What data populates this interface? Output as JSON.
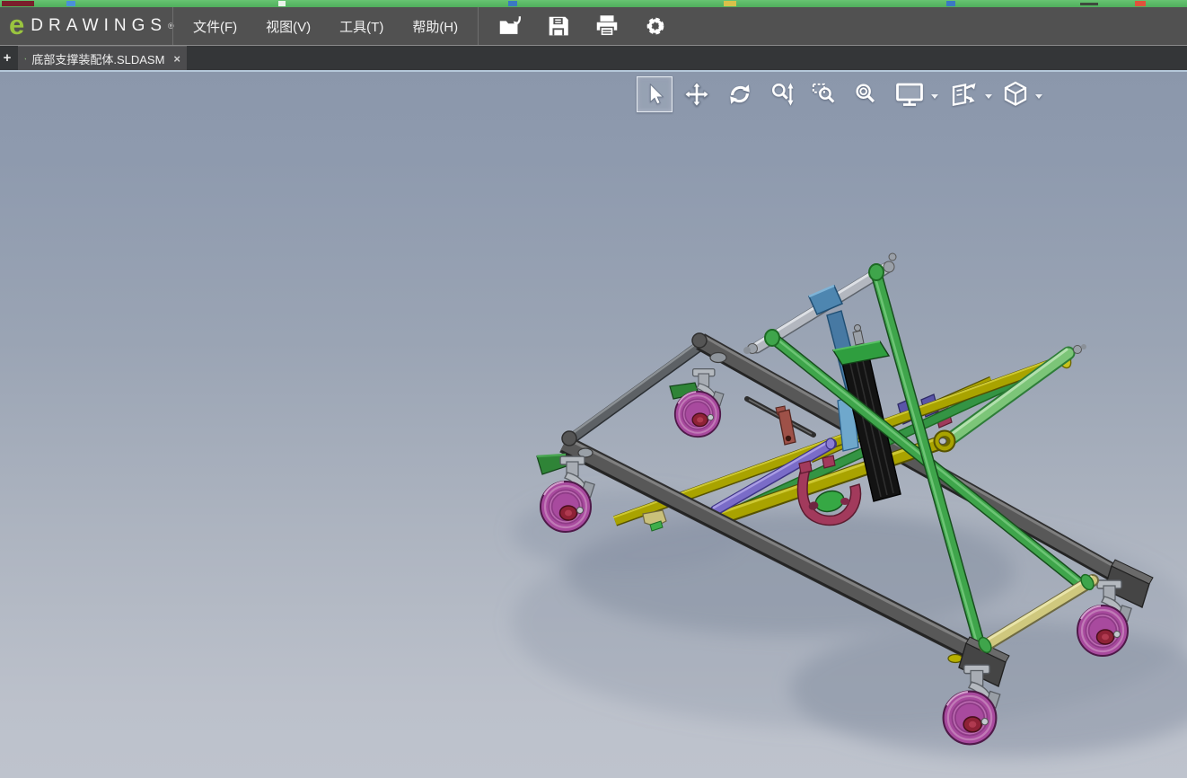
{
  "header": {
    "logo": {
      "e": "e",
      "wordmark": "DRAWINGS",
      "registered": "®"
    },
    "menus": [
      {
        "label": "文件(F)"
      },
      {
        "label": "视图(V)"
      },
      {
        "label": "工具(T)"
      },
      {
        "label": "帮助(H)"
      }
    ],
    "toolbar": [
      {
        "name": "open",
        "icon": "open-file-icon"
      },
      {
        "name": "save",
        "icon": "save-icon"
      },
      {
        "name": "print",
        "icon": "print-icon"
      },
      {
        "name": "settings",
        "icon": "gear-icon"
      }
    ]
  },
  "tab_bar": {
    "new_tab_label": "+",
    "tabs": [
      {
        "title": "底部支撑装配体.SLDASM",
        "close_label": "×",
        "active": true,
        "icon": "assembly-icon"
      }
    ]
  },
  "view_toolbar": {
    "buttons": [
      {
        "name": "select",
        "icon": "cursor-icon",
        "active": true
      },
      {
        "name": "pan",
        "icon": "pan-icon"
      },
      {
        "name": "rotate",
        "icon": "rotate-icon"
      },
      {
        "name": "zoom",
        "icon": "zoom-icon"
      },
      {
        "name": "zoom-window",
        "icon": "zoom-window-icon"
      },
      {
        "name": "zoom-fit",
        "icon": "zoom-fit-icon"
      },
      {
        "name": "full-screen",
        "icon": "monitor-icon",
        "has_dropdown": true
      },
      {
        "name": "reset-view",
        "icon": "pages-icon",
        "has_dropdown": true
      },
      {
        "name": "view-orientation",
        "icon": "cube-icon",
        "has_dropdown": true
      }
    ]
  },
  "viewport": {
    "model_name": "底部支撑装配体",
    "colors": {
      "brand_green": "#9ac43f",
      "menubar_bg": "#515151",
      "tabbar_bg": "#343638",
      "viewport_top": "#8b97ab",
      "viewport_bottom": "#bec3cd",
      "frame_gray": "#585858",
      "arm_green": "#3fa54b",
      "bar_yellow": "#a9a300",
      "wheel_magenta": "#a84a9e",
      "hub_red": "#8e2236",
      "rod_silver": "#b3b7bf",
      "clamp_blue": "#4e86b0",
      "rod_purple": "#7a6cc8",
      "bracket_maroon": "#a23a5c",
      "actuator_black": "#161616",
      "cylinder_light_green": "#7cc578",
      "cylinder_pale_yellow": "#cfc87e"
    }
  }
}
